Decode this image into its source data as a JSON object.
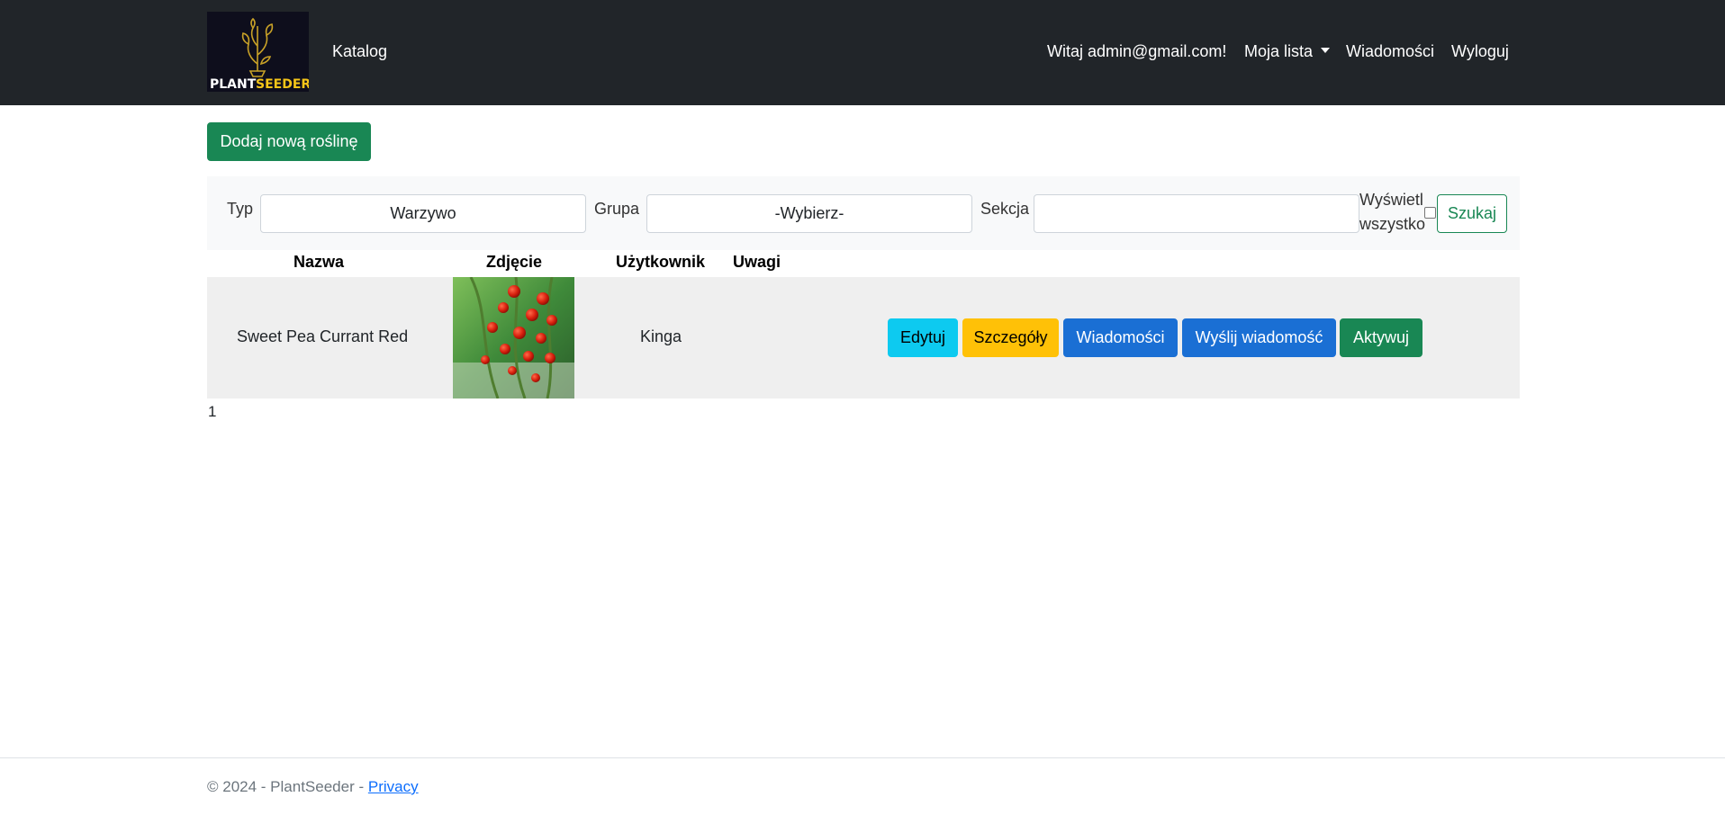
{
  "navbar": {
    "logo_text_plant": "PLANT",
    "logo_text_seeder": "SEEDER",
    "catalog_link": "Katalog",
    "greeting": "Witaj admin@gmail.com!",
    "my_list": "Moja lista",
    "messages": "Wiadomości",
    "logout": "Wyloguj"
  },
  "add_button": "Dodaj nową roślinę",
  "filters": {
    "type_label": "Typ",
    "type_value": "Warzywo",
    "group_label": "Grupa",
    "group_value": "-Wybierz-",
    "section_label": "Sekcja",
    "section_value": "",
    "show_all_label_line1": "Wyświetl",
    "show_all_label_line2": "wszystko",
    "show_all_checked": false,
    "search_button": "Szukaj"
  },
  "table": {
    "headers": [
      "Nazwa",
      "Zdjęcie",
      "Użytkownik",
      "Uwagi"
    ],
    "rows": [
      {
        "name": "Sweet Pea Currant Red",
        "photo_icon": "tomato-plant-photo",
        "user": "Kinga",
        "notes": "",
        "actions": [
          "Edytuj",
          "Szczegóły",
          "Wiadomości",
          "Wyślij wiadomość",
          "Aktywuj"
        ]
      }
    ]
  },
  "pagination": "1",
  "footer": {
    "copyright": "© 2024 - PlantSeeder - ",
    "privacy_link": "Privacy"
  },
  "colors": {
    "navbar_bg": "#212529",
    "success": "#198754",
    "info": "#0dcaf0",
    "warning": "#ffc107",
    "primary": "#1a6fd4",
    "logo_accent": "#f5c518"
  }
}
